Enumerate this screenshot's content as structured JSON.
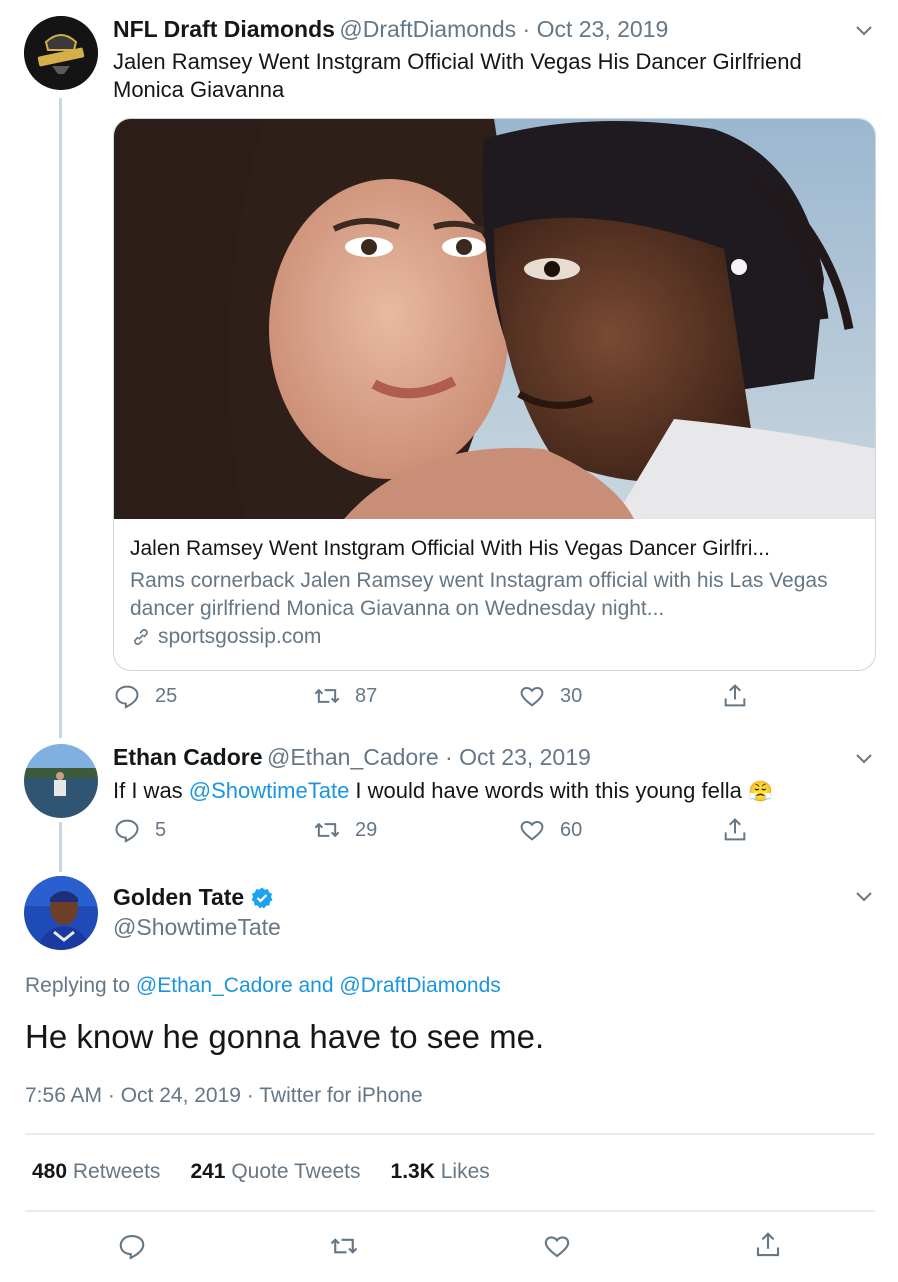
{
  "tweet1": {
    "name": "NFL Draft Diamonds",
    "handle": "@DraftDiamonds · Oct 23, 2019",
    "text": "Jalen Ramsey Went Instgram Official With Vegas His Dancer Girlfriend Monica Giavanna",
    "card": {
      "title": "Jalen Ramsey Went Instgram Official With His Vegas Dancer Girlfri...",
      "description": "Rams cornerback Jalen Ramsey went Instagram official with his Las Vegas dancer girlfriend Monica Giavanna on Wednesday night...",
      "domain": "sportsgossip.com"
    },
    "replies": "25",
    "retweets": "87",
    "likes": "30"
  },
  "tweet2": {
    "name": "Ethan Cadore",
    "handle": "@Ethan_Cadore · Oct 23, 2019",
    "text_pre": "If I was ",
    "mention": "@ShowtimeTate",
    "text_post": " I would have words with this young fella",
    "emoji": "😤",
    "replies": "5",
    "retweets": "29",
    "likes": "60"
  },
  "main_tweet": {
    "name": "Golden Tate",
    "handle": "@ShowtimeTate",
    "replying_prefix": "Replying to ",
    "replying_to_1": "@Ethan_Cadore",
    "replying_and": " and ",
    "replying_to_2": "@DraftDiamonds",
    "text": "He know he gonna have to see me.",
    "meta": "7:56 AM · Oct 24, 2019 · Twitter for iPhone",
    "retweets_count": "480",
    "retweets_label": "Retweets",
    "quotes_count": "241",
    "quotes_label": "Quote Tweets",
    "likes_count": "1.3K",
    "likes_label": "Likes"
  },
  "colors": {
    "accent": "#1b95e0",
    "verified": "#1da1f2",
    "muted": "#657786"
  }
}
